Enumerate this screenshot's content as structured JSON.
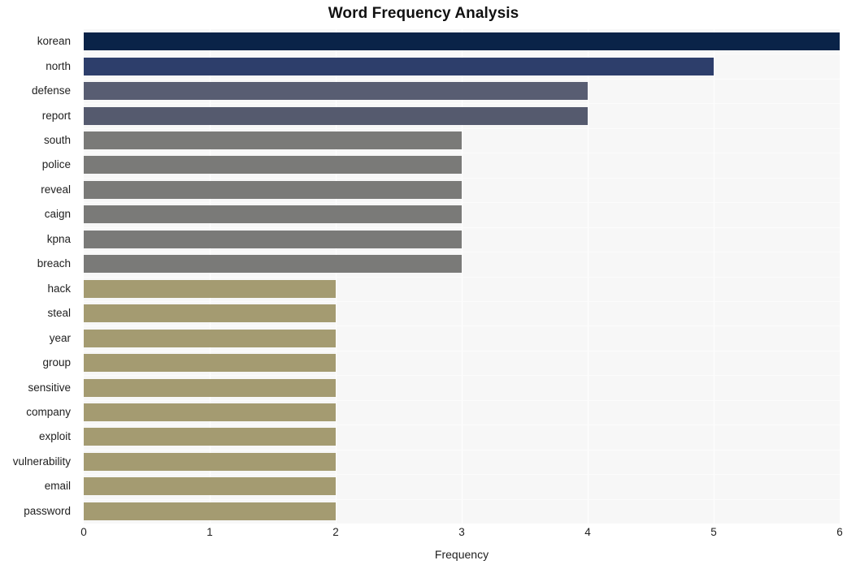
{
  "chart_data": {
    "type": "bar",
    "orientation": "horizontal",
    "title": "Word Frequency Analysis",
    "xlabel": "Frequency",
    "ylabel": "",
    "xlim": [
      0,
      6
    ],
    "xticks": [
      "0",
      "1",
      "2",
      "3",
      "4",
      "5",
      "6"
    ],
    "grid": true,
    "legend": "none",
    "categories": [
      "korean",
      "north",
      "defense",
      "report",
      "south",
      "police",
      "reveal",
      "caign",
      "kpna",
      "breach",
      "hack",
      "steal",
      "year",
      "group",
      "sensitive",
      "company",
      "exploit",
      "vulnerability",
      "email",
      "password"
    ],
    "values": [
      6,
      5,
      4,
      4,
      3,
      3,
      3,
      3,
      3,
      3,
      2,
      2,
      2,
      2,
      2,
      2,
      2,
      2,
      2,
      2
    ],
    "bar_colors": [
      "#0a2348",
      "#2d3e6b",
      "#585d72",
      "#555a6e",
      "#7a7a78",
      "#7a7a78",
      "#7a7a78",
      "#7a7a78",
      "#7a7a78",
      "#7a7a78",
      "#a49b71",
      "#a49b71",
      "#a49b71",
      "#a49b71",
      "#a49b71",
      "#a49b71",
      "#a49b71",
      "#a49b71",
      "#a49b71",
      "#a49b71"
    ]
  },
  "style": {
    "plot_background": "#f7f7f7",
    "page_background": "#ffffff",
    "gridline_color": "#ffffff",
    "text_color": "#1f1f1f"
  }
}
